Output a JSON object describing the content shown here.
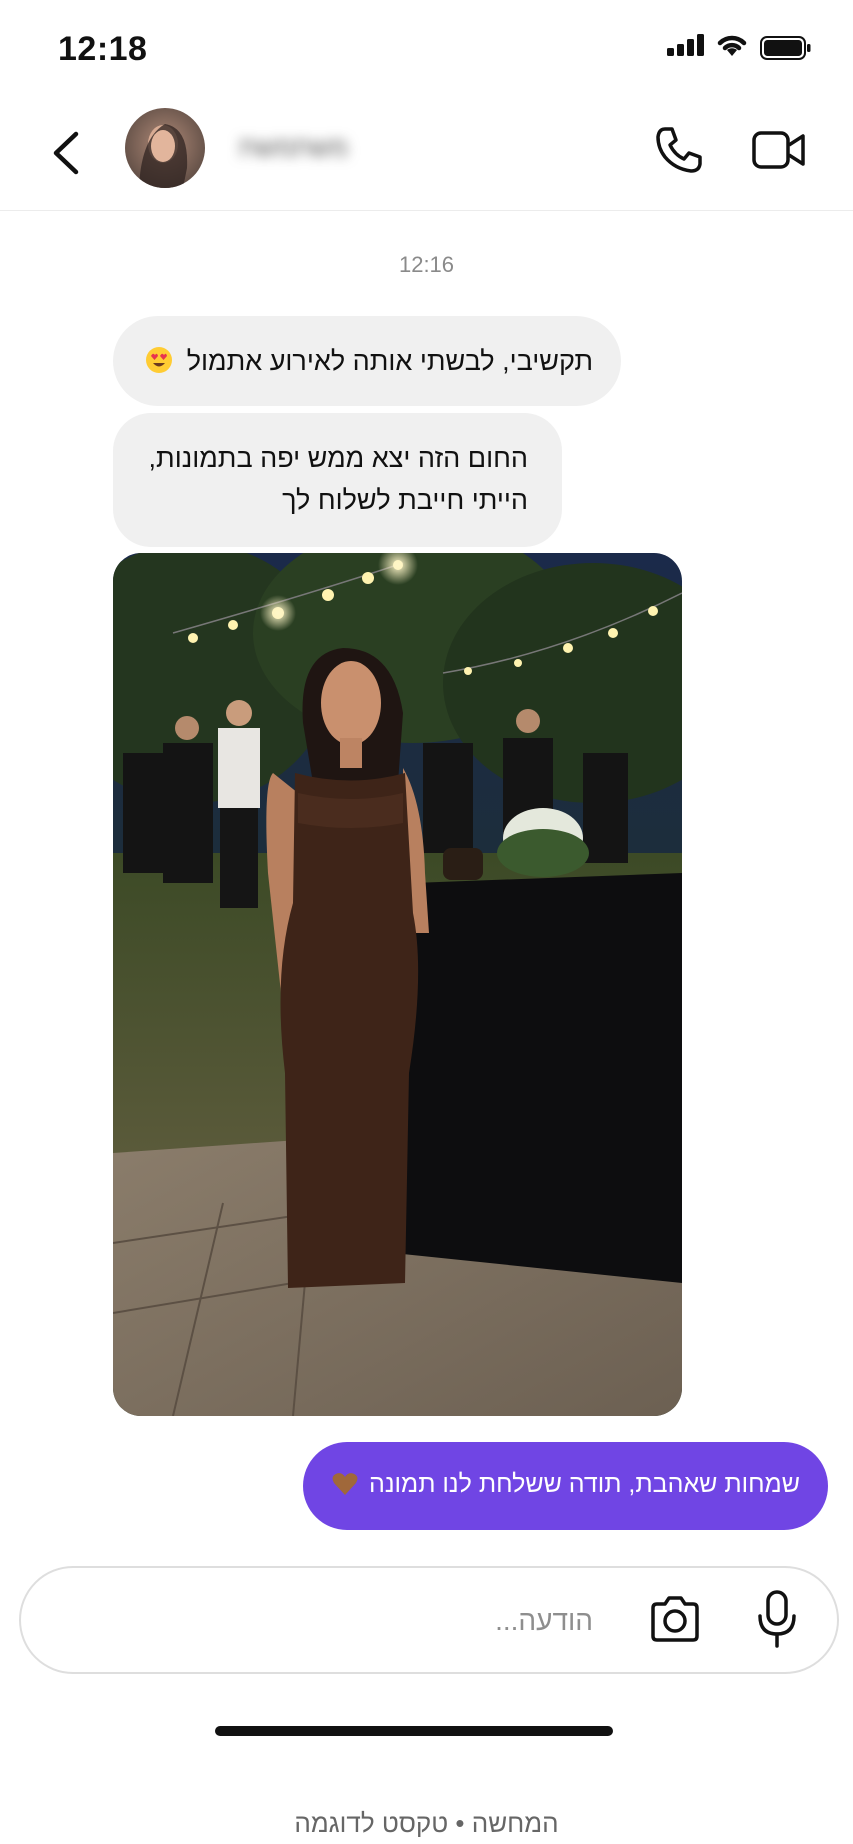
{
  "status_bar": {
    "time": "12:18",
    "icons": [
      "signal-icon",
      "wifi-icon",
      "battery-icon"
    ]
  },
  "header": {
    "contact_name": "משתמשת",
    "icons": [
      "back-chevron-icon",
      "phone-icon",
      "video-camera-icon"
    ]
  },
  "chat": {
    "timestamp": "12:16",
    "messages": [
      {
        "direction": "received",
        "text": "תקשיבי, לבשתי אותה לאירוע אתמול",
        "emoji": "heart-eyes-emoji"
      },
      {
        "direction": "received",
        "lines": [
          "החום הזה יצא ממש יפה בתמונות,",
          "הייתי חייבת לשלוח לך"
        ]
      },
      {
        "direction": "received",
        "type": "photo",
        "description_icon": "event-photo"
      },
      {
        "direction": "sent",
        "text": "שמחות שאהבת, תודה ששלחת לנו תמונה",
        "emoji": "brown-heart-emoji"
      }
    ]
  },
  "composer": {
    "placeholder": "הודעה...",
    "icons": [
      "camera-icon",
      "microphone-icon"
    ]
  },
  "caption": "המחשה • טקסט לדוגמה",
  "colors": {
    "sent_bubble": "#7045e4",
    "received_bubble": "#f0f0f0",
    "background": "#ffffff"
  }
}
